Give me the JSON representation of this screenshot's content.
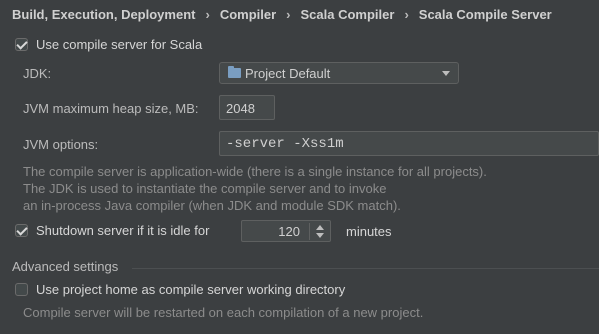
{
  "breadcrumb": [
    "Build, Execution, Deployment",
    "Compiler",
    "Scala Compiler",
    "Scala Compile Server"
  ],
  "use_compile_server": {
    "label": "Use compile server for Scala",
    "checked": true
  },
  "jdk": {
    "label": "JDK:",
    "value": "Project Default"
  },
  "heap": {
    "label": "JVM maximum heap size, MB:",
    "value": "2048"
  },
  "jvm_options": {
    "label": "JVM options:",
    "value": "-server -Xss1m"
  },
  "help_lines": [
    "The compile server is application-wide (there is a single instance for all projects).",
    "The JDK is used to instantiate the compile server and to invoke",
    "an in-process Java compiler (when JDK and module SDK match)."
  ],
  "shutdown": {
    "label": "Shutdown server if it is idle for",
    "checked": true,
    "value": "120",
    "unit": "minutes"
  },
  "advanced": {
    "title": "Advanced settings",
    "use_project_home": {
      "label": "Use project home as compile server working directory",
      "checked": false
    },
    "note": "Compile server will be restarted on each compilation of a new project."
  }
}
